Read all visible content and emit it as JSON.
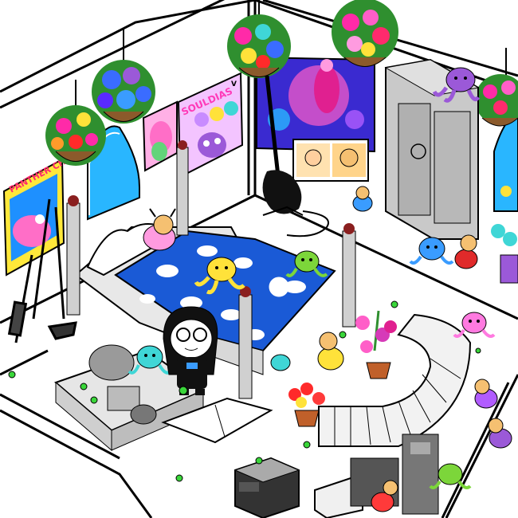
{
  "scene": {
    "posters": {
      "panther_chaps_title": "PANTHER CHAPS",
      "skull_poster_title": "SOULDIAS",
      "skull_poster_mark": "V"
    },
    "colors": {
      "background": "#ffffff",
      "outline": "#000000",
      "bedspread": "#1a5ad6",
      "pillow": "#ffffff",
      "panther_poster_bg": "#1e90ff",
      "panther_poster_pink": "#ff6ec7",
      "skull_poster_bg": "#f0c0ff",
      "wardrobe": "#c9c9c9",
      "octopus_purple": "#9b59d8",
      "octopus_yellow": "#ffe23a",
      "octopus_green": "#7cd63a",
      "octopus_cyan": "#3fd6d6",
      "octopus_blue": "#3a9cff",
      "octopus_pink": "#ff7ae0"
    },
    "icons": {
      "hanging_planters": [
        "flower-basket-icon",
        "flower-basket-icon",
        "flower-basket-icon",
        "flower-basket-icon",
        "flower-basket-icon"
      ],
      "plushes": [
        "octopus-plush-icon",
        "octopus-plush-icon",
        "octopus-plush-icon",
        "octopus-plush-icon",
        "octopus-plush-icon",
        "octopus-plush-icon",
        "octopus-plush-icon",
        "octopus-plush-icon"
      ],
      "character": "character-sprite-icon",
      "guitar": "bass-guitar-icon"
    }
  }
}
